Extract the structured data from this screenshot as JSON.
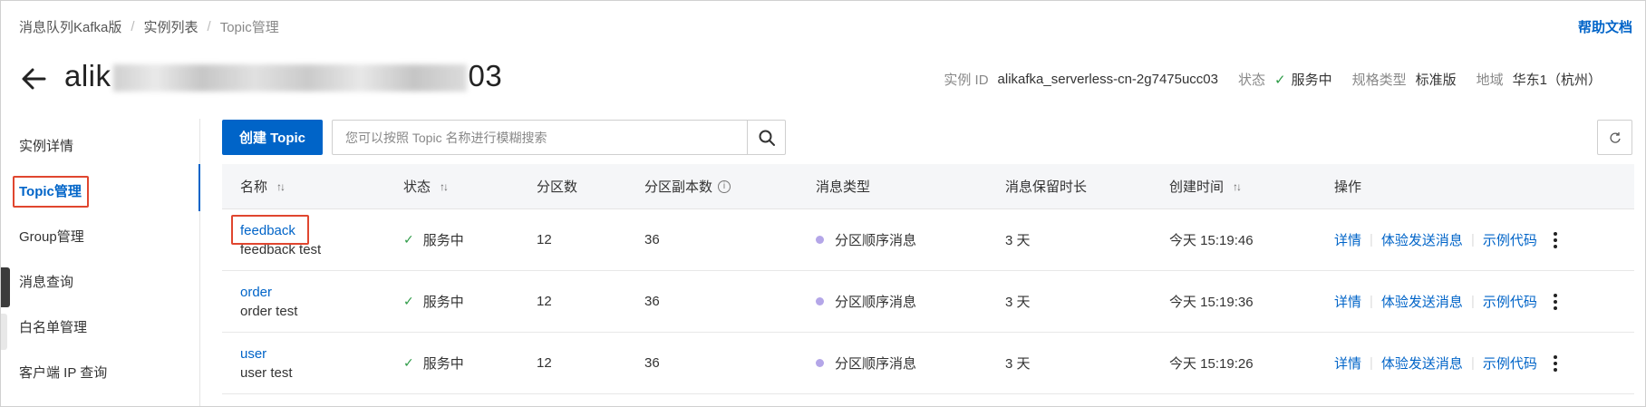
{
  "breadcrumb": [
    "消息队列Kafka版",
    "实例列表",
    "Topic管理"
  ],
  "help_label": "帮助文档",
  "title": {
    "prefix": "alik",
    "middle_1": "_",
    "suffix": "03"
  },
  "meta": {
    "instance_id_label": "实例 ID",
    "instance_id": "alikafka_serverless-cn-2g7475ucc03",
    "status_label": "状态",
    "status": "服务中",
    "spec_label": "规格类型",
    "spec": "标准版",
    "region_label": "地域",
    "region": "华东1（杭州）"
  },
  "sidebar": {
    "items": [
      "实例详情",
      "Topic管理",
      "Group管理",
      "消息查询",
      "白名单管理",
      "客户端 IP 查询"
    ],
    "active": "Topic管理"
  },
  "toolbar": {
    "create_label": "创建 Topic",
    "search_placeholder": "您可以按照 Topic 名称进行模糊搜索"
  },
  "table": {
    "headers": {
      "name": "名称",
      "status": "状态",
      "partitions": "分区数",
      "replicas": "分区副本数",
      "msg_type": "消息类型",
      "retention": "消息保留时长",
      "created": "创建时间",
      "actions": "操作"
    },
    "rows": [
      {
        "name": "feedback",
        "desc": "feedback test",
        "status": "服务中",
        "partitions": "12",
        "replicas": "36",
        "msg_type": "分区顺序消息",
        "retention": "3 天",
        "created": "今天 15:19:46"
      },
      {
        "name": "order",
        "desc": "order test",
        "status": "服务中",
        "partitions": "12",
        "replicas": "36",
        "msg_type": "分区顺序消息",
        "retention": "3 天",
        "created": "今天 15:19:36"
      },
      {
        "name": "user",
        "desc": "user test",
        "status": "服务中",
        "partitions": "12",
        "replicas": "36",
        "msg_type": "分区顺序消息",
        "retention": "3 天",
        "created": "今天 15:19:26"
      }
    ],
    "actions": [
      "详情",
      "体验发送消息",
      "示例代码"
    ]
  },
  "colors": {
    "accent": "#0064c8",
    "success": "#2e9b47",
    "highlight": "#e0462f",
    "dot": "#b4a6e8"
  },
  "icons": [
    "back-arrow-icon",
    "search-icon",
    "refresh-icon",
    "sort-icon",
    "info-icon",
    "check-icon",
    "more-icon"
  ]
}
